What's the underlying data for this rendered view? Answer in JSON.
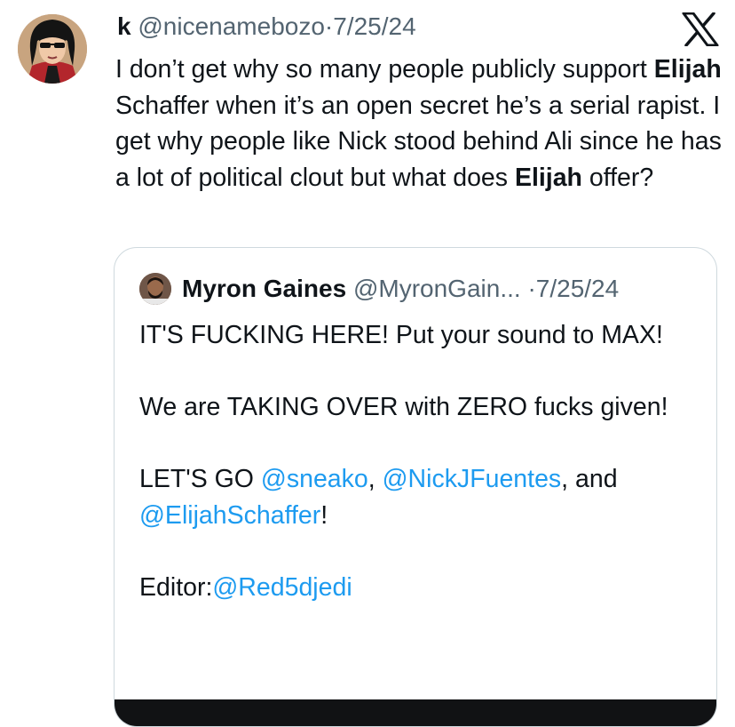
{
  "tweet": {
    "author_name": "k",
    "author_handle": "@nicenamebozo",
    "separator": "·",
    "date": "7/25/24",
    "avatar_icon": "cartoon-avatar-icon",
    "logo_icon": "x-logo-icon",
    "text_parts": [
      "I don’t get why so many people publicly support ",
      "Elijah",
      " Schaffer when it’s an open secret he’s a serial rapist. I get why people like Nick stood behind Ali since he has a lot of political clout but what does ",
      "Elijah",
      " offer?"
    ]
  },
  "quote": {
    "author_name": "Myron Gaines",
    "author_handle": "@MyronGain...",
    "separator": "·",
    "date": "7/25/24",
    "avatar_icon": "profile-photo-icon",
    "line1": "IT'S FUCKING HERE! Put your sound to MAX!",
    "line2": "We are TAKING OVER with ZERO fucks given!",
    "line3_prefix": "LET'S GO ",
    "mention1": "@sneako",
    "line3_sep1": ", ",
    "mention2": "@NickJFuentes",
    "line3_sep2": ", and ",
    "mention3": "@ElijahSchaffer",
    "line3_suffix": "!",
    "editor_label": "Editor:",
    "editor_mention": "@Red5djedi"
  },
  "colors": {
    "text": "#0f1419",
    "muted": "#536471",
    "link": "#1d9bf0",
    "border": "#cfd9de"
  }
}
